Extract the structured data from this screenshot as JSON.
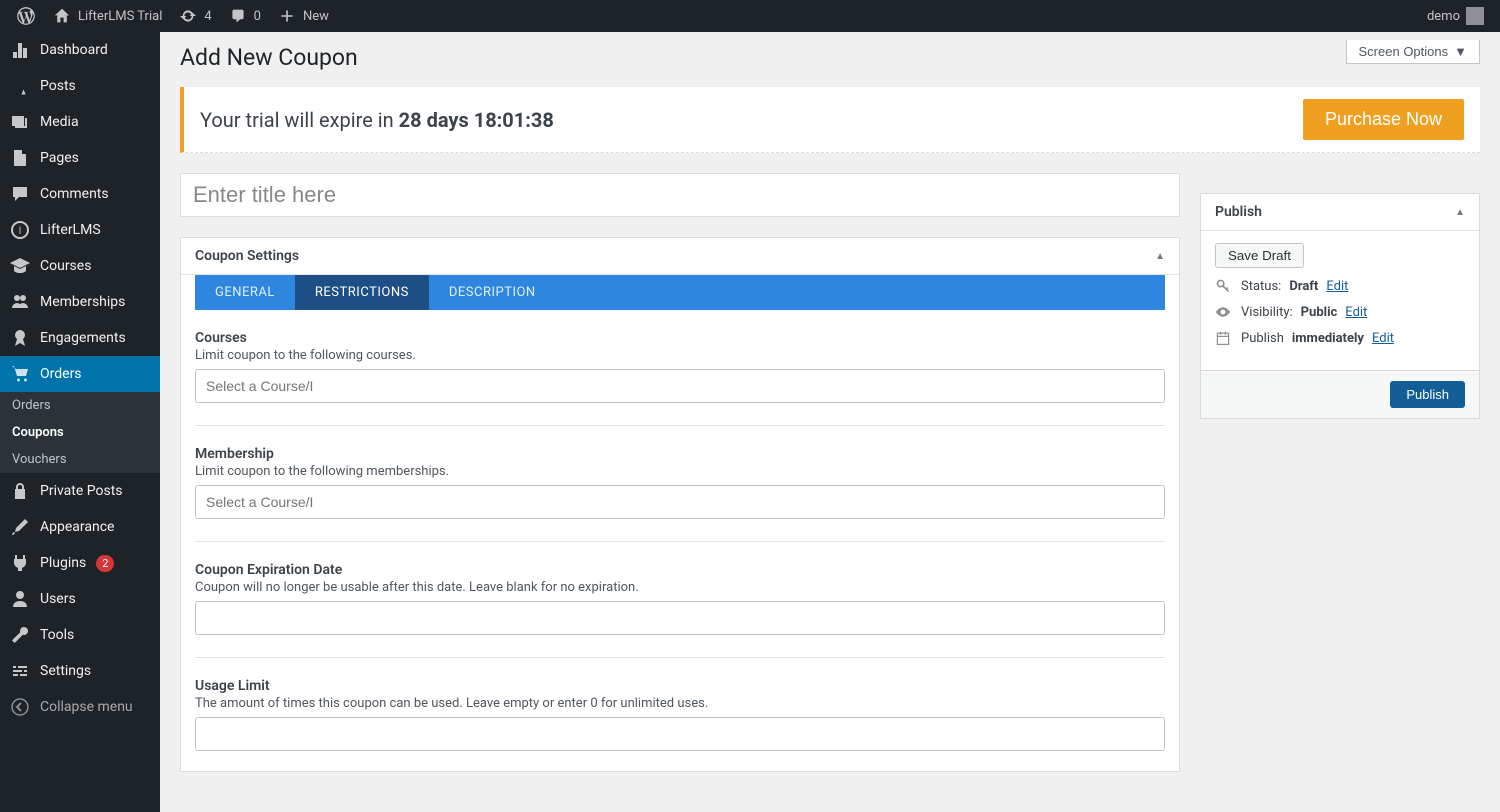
{
  "adminbar": {
    "site_name": "LifterLMS Trial",
    "updates_count": "4",
    "comments_count": "0",
    "new_label": "New",
    "user_greeting": "demo"
  },
  "sidebar": {
    "items": [
      {
        "label": "Dashboard"
      },
      {
        "label": "Posts"
      },
      {
        "label": "Media"
      },
      {
        "label": "Pages"
      },
      {
        "label": "Comments"
      },
      {
        "label": "LifterLMS"
      },
      {
        "label": "Courses"
      },
      {
        "label": "Memberships"
      },
      {
        "label": "Engagements"
      },
      {
        "label": "Orders"
      },
      {
        "label": "Private Posts"
      },
      {
        "label": "Appearance"
      },
      {
        "label": "Plugins"
      },
      {
        "label": "Users"
      },
      {
        "label": "Tools"
      },
      {
        "label": "Settings"
      }
    ],
    "orders_submenu": [
      {
        "label": "Orders"
      },
      {
        "label": "Coupons"
      },
      {
        "label": "Vouchers"
      }
    ],
    "plugins_badge": "2",
    "collapse_label": "Collapse menu"
  },
  "screen_options_label": "Screen Options",
  "page_title": "Add New Coupon",
  "trial": {
    "prefix": "Your trial will expire in ",
    "time": "28 days 18:01:38",
    "purchase_label": "Purchase Now"
  },
  "title_placeholder": "Enter title here",
  "box": {
    "header": "Coupon Settings",
    "tabs": {
      "general": "GENERAL",
      "restrictions": "RESTRICTIONS",
      "description": "DESCRIPTION"
    },
    "fields": {
      "courses": {
        "label": "Courses",
        "desc": "Limit coupon to the following courses.",
        "placeholder": "Select a Course/I"
      },
      "membership": {
        "label": "Membership",
        "desc": "Limit coupon to the following memberships.",
        "placeholder": "Select a Course/I"
      },
      "expiration": {
        "label": "Coupon Expiration Date",
        "desc": "Coupon will no longer be usable after this date. Leave blank for no expiration."
      },
      "usage": {
        "label": "Usage Limit",
        "desc": "The amount of times this coupon can be used. Leave empty or enter 0 for unlimited uses."
      }
    }
  },
  "publish": {
    "header": "Publish",
    "save_draft": "Save Draft",
    "status_label": "Status:",
    "status_value": "Draft",
    "visibility_label": "Visibility:",
    "visibility_value": "Public",
    "schedule_label": "Publish",
    "schedule_value": "immediately",
    "edit_label": "Edit",
    "publish_button": "Publish"
  }
}
